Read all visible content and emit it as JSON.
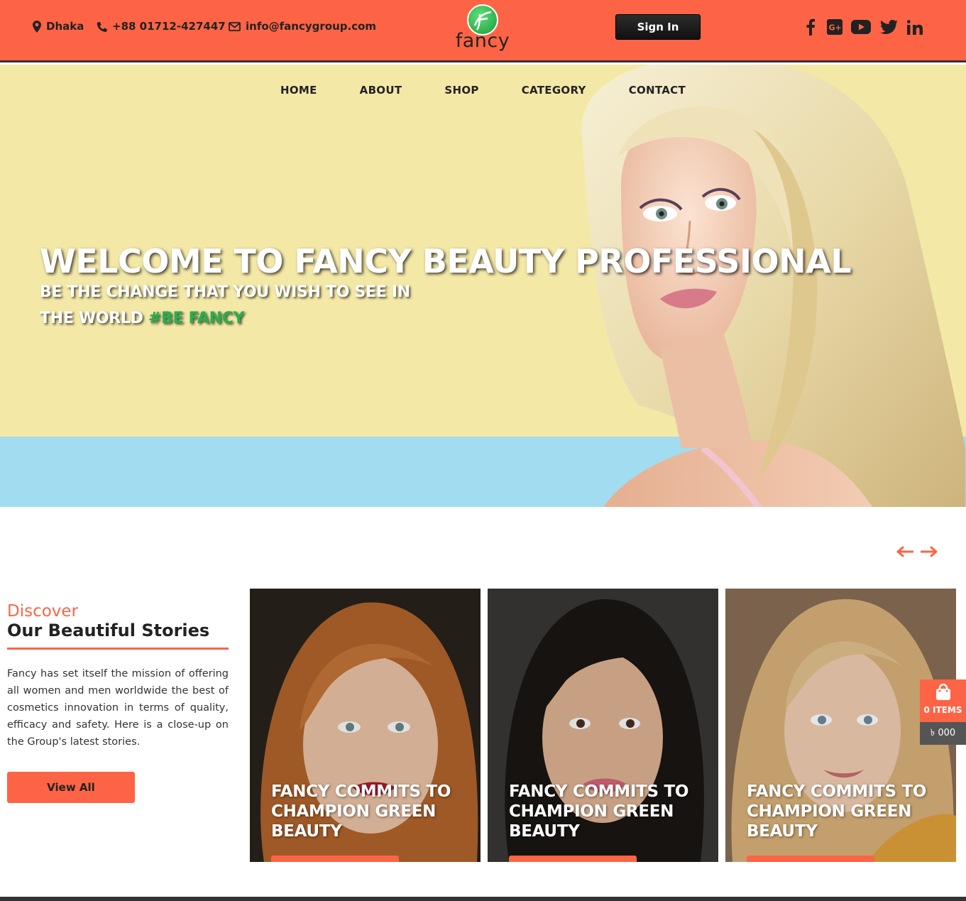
{
  "topbar": {
    "location": "Dhaka",
    "phone": "+88 01712-427447",
    "email": "info@fancygroup.com",
    "logo_text": "fancy",
    "logo_letter": "f",
    "signin_label": "Sign In",
    "socials": [
      "facebook-icon",
      "google-plus-icon",
      "youtube-icon",
      "twitter-icon",
      "linkedin-icon"
    ]
  },
  "nav": {
    "items": [
      "HOME",
      "ABOUT",
      "SHOP",
      "CATEGORY",
      "CONTACT"
    ]
  },
  "hero": {
    "title": "WELCOME TO FANCY BEAUTY PROFESSIONAL",
    "sub_line1": "BE THE CHANGE THAT YOU WISH TO SEE IN",
    "sub_line2": "THE WORLD",
    "hashtag": "#BE FANCY"
  },
  "stories": {
    "discover": "Discover",
    "title": "Our Beautiful Stories",
    "description": "Fancy has set itself the mission of offering all women and men worldwide the best of cosmetics innovation in terms of quality, efficacy and safety. Here is a close-up on the Group's latest stories.",
    "view_all": "View All",
    "cards": [
      {
        "title": "FANCY COMMITS TO CHAMPION GREEN BEAUTY"
      },
      {
        "title": "FANCY COMMITS TO CHAMPION GREEN BEAUTY"
      },
      {
        "title": "FANCY COMMITS TO CHAMPION GREEN BEAUTY"
      }
    ]
  },
  "cart": {
    "items": "0 ITEMS",
    "total": "৳ 000"
  },
  "colors": {
    "accent": "#fd6446",
    "hero_yellow": "#f4e8a7",
    "hero_blue": "#a2dcf0",
    "hashtag_green": "#27b04a"
  }
}
